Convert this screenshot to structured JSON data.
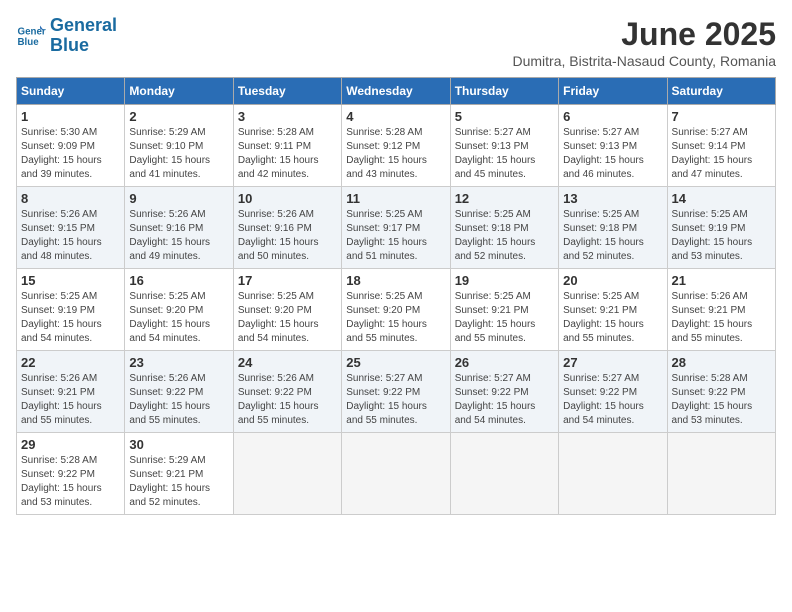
{
  "logo": {
    "line1": "General",
    "line2": "Blue"
  },
  "title": "June 2025",
  "location": "Dumitra, Bistrita-Nasaud County, Romania",
  "header_days": [
    "Sunday",
    "Monday",
    "Tuesday",
    "Wednesday",
    "Thursday",
    "Friday",
    "Saturday"
  ],
  "weeks": [
    [
      {
        "day": "1",
        "info": "Sunrise: 5:30 AM\nSunset: 9:09 PM\nDaylight: 15 hours\nand 39 minutes."
      },
      {
        "day": "2",
        "info": "Sunrise: 5:29 AM\nSunset: 9:10 PM\nDaylight: 15 hours\nand 41 minutes."
      },
      {
        "day": "3",
        "info": "Sunrise: 5:28 AM\nSunset: 9:11 PM\nDaylight: 15 hours\nand 42 minutes."
      },
      {
        "day": "4",
        "info": "Sunrise: 5:28 AM\nSunset: 9:12 PM\nDaylight: 15 hours\nand 43 minutes."
      },
      {
        "day": "5",
        "info": "Sunrise: 5:27 AM\nSunset: 9:13 PM\nDaylight: 15 hours\nand 45 minutes."
      },
      {
        "day": "6",
        "info": "Sunrise: 5:27 AM\nSunset: 9:13 PM\nDaylight: 15 hours\nand 46 minutes."
      },
      {
        "day": "7",
        "info": "Sunrise: 5:27 AM\nSunset: 9:14 PM\nDaylight: 15 hours\nand 47 minutes."
      }
    ],
    [
      {
        "day": "8",
        "info": "Sunrise: 5:26 AM\nSunset: 9:15 PM\nDaylight: 15 hours\nand 48 minutes."
      },
      {
        "day": "9",
        "info": "Sunrise: 5:26 AM\nSunset: 9:16 PM\nDaylight: 15 hours\nand 49 minutes."
      },
      {
        "day": "10",
        "info": "Sunrise: 5:26 AM\nSunset: 9:16 PM\nDaylight: 15 hours\nand 50 minutes."
      },
      {
        "day": "11",
        "info": "Sunrise: 5:25 AM\nSunset: 9:17 PM\nDaylight: 15 hours\nand 51 minutes."
      },
      {
        "day": "12",
        "info": "Sunrise: 5:25 AM\nSunset: 9:18 PM\nDaylight: 15 hours\nand 52 minutes."
      },
      {
        "day": "13",
        "info": "Sunrise: 5:25 AM\nSunset: 9:18 PM\nDaylight: 15 hours\nand 52 minutes."
      },
      {
        "day": "14",
        "info": "Sunrise: 5:25 AM\nSunset: 9:19 PM\nDaylight: 15 hours\nand 53 minutes."
      }
    ],
    [
      {
        "day": "15",
        "info": "Sunrise: 5:25 AM\nSunset: 9:19 PM\nDaylight: 15 hours\nand 54 minutes."
      },
      {
        "day": "16",
        "info": "Sunrise: 5:25 AM\nSunset: 9:20 PM\nDaylight: 15 hours\nand 54 minutes."
      },
      {
        "day": "17",
        "info": "Sunrise: 5:25 AM\nSunset: 9:20 PM\nDaylight: 15 hours\nand 54 minutes."
      },
      {
        "day": "18",
        "info": "Sunrise: 5:25 AM\nSunset: 9:20 PM\nDaylight: 15 hours\nand 55 minutes."
      },
      {
        "day": "19",
        "info": "Sunrise: 5:25 AM\nSunset: 9:21 PM\nDaylight: 15 hours\nand 55 minutes."
      },
      {
        "day": "20",
        "info": "Sunrise: 5:25 AM\nSunset: 9:21 PM\nDaylight: 15 hours\nand 55 minutes."
      },
      {
        "day": "21",
        "info": "Sunrise: 5:26 AM\nSunset: 9:21 PM\nDaylight: 15 hours\nand 55 minutes."
      }
    ],
    [
      {
        "day": "22",
        "info": "Sunrise: 5:26 AM\nSunset: 9:21 PM\nDaylight: 15 hours\nand 55 minutes."
      },
      {
        "day": "23",
        "info": "Sunrise: 5:26 AM\nSunset: 9:22 PM\nDaylight: 15 hours\nand 55 minutes."
      },
      {
        "day": "24",
        "info": "Sunrise: 5:26 AM\nSunset: 9:22 PM\nDaylight: 15 hours\nand 55 minutes."
      },
      {
        "day": "25",
        "info": "Sunrise: 5:27 AM\nSunset: 9:22 PM\nDaylight: 15 hours\nand 55 minutes."
      },
      {
        "day": "26",
        "info": "Sunrise: 5:27 AM\nSunset: 9:22 PM\nDaylight: 15 hours\nand 54 minutes."
      },
      {
        "day": "27",
        "info": "Sunrise: 5:27 AM\nSunset: 9:22 PM\nDaylight: 15 hours\nand 54 minutes."
      },
      {
        "day": "28",
        "info": "Sunrise: 5:28 AM\nSunset: 9:22 PM\nDaylight: 15 hours\nand 53 minutes."
      }
    ],
    [
      {
        "day": "29",
        "info": "Sunrise: 5:28 AM\nSunset: 9:22 PM\nDaylight: 15 hours\nand 53 minutes."
      },
      {
        "day": "30",
        "info": "Sunrise: 5:29 AM\nSunset: 9:21 PM\nDaylight: 15 hours\nand 52 minutes."
      },
      {
        "day": "",
        "info": ""
      },
      {
        "day": "",
        "info": ""
      },
      {
        "day": "",
        "info": ""
      },
      {
        "day": "",
        "info": ""
      },
      {
        "day": "",
        "info": ""
      }
    ]
  ]
}
